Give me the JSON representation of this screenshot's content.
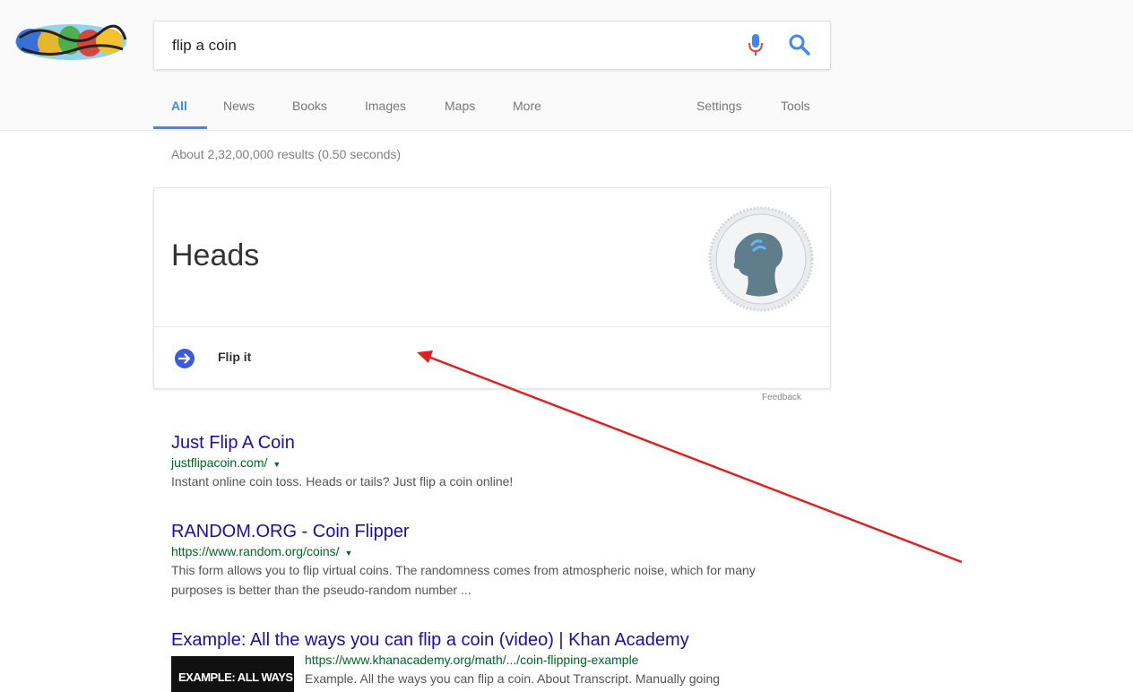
{
  "search": {
    "query": "flip a coin"
  },
  "tabs": {
    "all": "All",
    "news": "News",
    "books": "Books",
    "images": "Images",
    "maps": "Maps",
    "more": "More",
    "settings": "Settings",
    "tools": "Tools"
  },
  "result_stats": "About 2,32,00,000 results (0.50 seconds)",
  "coin_card": {
    "result": "Heads",
    "flip_label": "Flip it",
    "feedback": "Feedback"
  },
  "results": [
    {
      "title": "Just Flip A Coin",
      "url": "justflipacoin.com/",
      "snippet": "Instant online coin toss. Heads or tails? Just flip a coin online!"
    },
    {
      "title": "RANDOM.ORG - Coin Flipper",
      "url": "https://www.random.org/coins/",
      "snippet": "This form allows you to flip virtual coins. The randomness comes from atmospheric noise, which for many purposes is better than the pseudo-random number ..."
    },
    {
      "title": "Example: All the ways you can flip a coin (video) | Khan Academy",
      "url": "https://www.khanacademy.org/math/.../coin-flipping-example",
      "snippet": "Example. All the ways you can flip a coin. About Transcript. Manually going",
      "thumbnail_text": "EXAMPLE: ALL WAYS"
    }
  ],
  "colors": {
    "accent_blue": "#4285f4",
    "link_blue": "#1a0dab",
    "url_green": "#006621",
    "annotation_red": "#e02020"
  }
}
